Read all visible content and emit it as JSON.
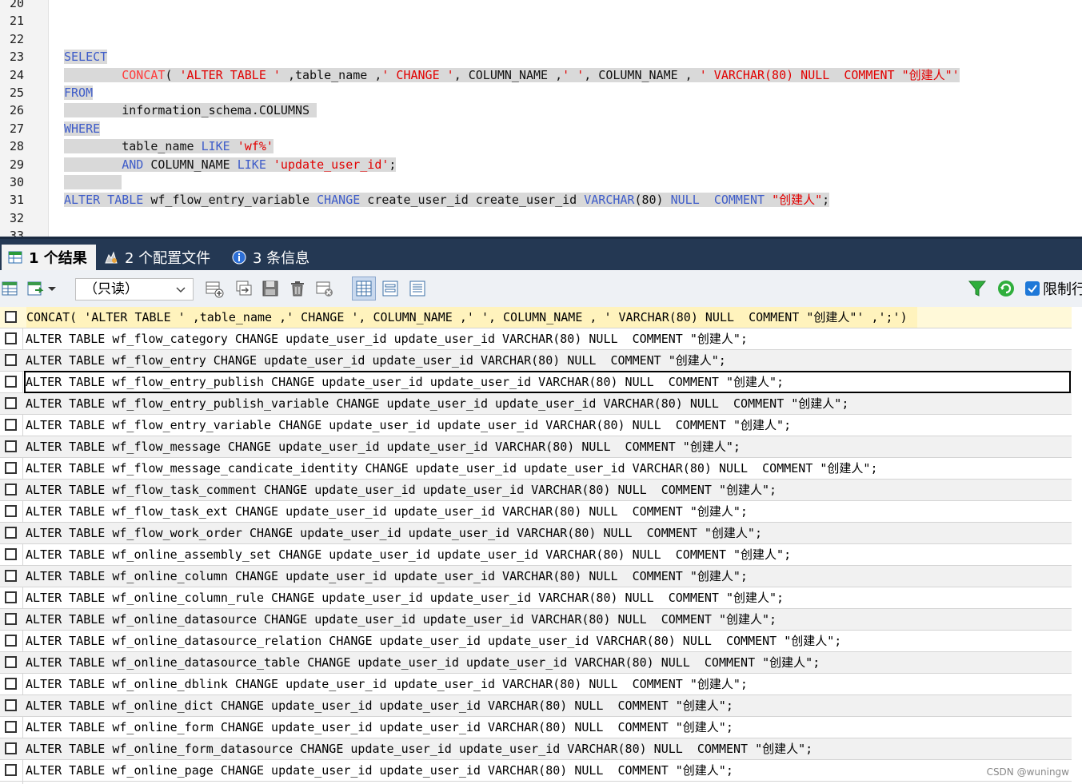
{
  "editor": {
    "line_numbers": [
      "20",
      "21",
      "22",
      "23",
      "24",
      "25",
      "26",
      "27",
      "28",
      "29",
      "30",
      "31",
      "32",
      "33"
    ],
    "lines": [
      {
        "num_index": 3,
        "tokens": [
          {
            "t": "SELECT",
            "c": "kw"
          }
        ]
      },
      {
        "num_index": 4,
        "tokens": [
          {
            "t": "        ",
            "c": "id"
          },
          {
            "t": "CONCAT",
            "c": "fn"
          },
          {
            "t": "( ",
            "c": "id"
          },
          {
            "t": "'ALTER TABLE '",
            "c": "str"
          },
          {
            "t": " ,table_name ,",
            "c": "id"
          },
          {
            "t": "' CHANGE '",
            "c": "str"
          },
          {
            "t": ", COLUMN_NAME ,",
            "c": "id"
          },
          {
            "t": "' '",
            "c": "str"
          },
          {
            "t": ", COLUMN_NAME , ",
            "c": "id"
          },
          {
            "t": "' VARCHAR(80) NULL  COMMENT \"创建人\"'",
            "c": "str"
          }
        ]
      },
      {
        "num_index": 5,
        "tokens": [
          {
            "t": "FROM",
            "c": "kw"
          }
        ]
      },
      {
        "num_index": 6,
        "tokens": [
          {
            "t": "        information_schema.COLUMNS ",
            "c": "id"
          }
        ]
      },
      {
        "num_index": 7,
        "tokens": [
          {
            "t": "WHERE",
            "c": "kw"
          }
        ]
      },
      {
        "num_index": 8,
        "tokens": [
          {
            "t": "        table_name ",
            "c": "id"
          },
          {
            "t": "LIKE",
            "c": "kw"
          },
          {
            "t": " ",
            "c": "id"
          },
          {
            "t": "'wf%'",
            "c": "str"
          }
        ]
      },
      {
        "num_index": 9,
        "tokens": [
          {
            "t": "        ",
            "c": "id"
          },
          {
            "t": "AND",
            "c": "kw"
          },
          {
            "t": " COLUMN_NAME ",
            "c": "id"
          },
          {
            "t": "LIKE",
            "c": "kw"
          },
          {
            "t": " ",
            "c": "id"
          },
          {
            "t": "'update_user_id'",
            "c": "str"
          },
          {
            "t": ";",
            "c": "id"
          }
        ]
      },
      {
        "num_index": 10,
        "tokens": [
          {
            "t": "        ",
            "c": "id"
          }
        ]
      },
      {
        "num_index": 11,
        "tokens": [
          {
            "t": "ALTER TABLE",
            "c": "kw"
          },
          {
            "t": " wf_flow_entry_variable ",
            "c": "id"
          },
          {
            "t": "CHANGE",
            "c": "kw"
          },
          {
            "t": " create_user_id create_user_id ",
            "c": "id"
          },
          {
            "t": "VARCHAR",
            "c": "kw"
          },
          {
            "t": "(80) ",
            "c": "id"
          },
          {
            "t": "NULL",
            "c": "kw"
          },
          {
            "t": "  ",
            "c": "id"
          },
          {
            "t": "COMMENT",
            "c": "kw"
          },
          {
            "t": " ",
            "c": "id"
          },
          {
            "t": "\"创建人\"",
            "c": "str"
          },
          {
            "t": ";",
            "c": "id"
          }
        ]
      }
    ]
  },
  "tabs": [
    {
      "label": "1 个结果",
      "icon": "result-grid-icon",
      "active": true
    },
    {
      "label": "2 个配置文件",
      "icon": "profile-icon",
      "active": false
    },
    {
      "label": "3 条信息",
      "icon": "info-icon",
      "active": false
    }
  ],
  "toolbar": {
    "mode_select": "（只读）",
    "limit_label": "限制行"
  },
  "grid": {
    "header": "CONCAT( 'ALTER TABLE ' ,table_name ,' CHANGE ', COLUMN_NAME ,' ', COLUMN_NAME , ' VARCHAR(80) NULL  COMMENT \"创建人\"' ,';')",
    "selected_index": 2,
    "rows": [
      "ALTER TABLE wf_flow_category CHANGE update_user_id update_user_id VARCHAR(80) NULL  COMMENT \"创建人\";",
      "ALTER TABLE wf_flow_entry CHANGE update_user_id update_user_id VARCHAR(80) NULL  COMMENT \"创建人\";",
      "ALTER TABLE wf_flow_entry_publish CHANGE update_user_id update_user_id VARCHAR(80) NULL  COMMENT \"创建人\";",
      "ALTER TABLE wf_flow_entry_publish_variable CHANGE update_user_id update_user_id VARCHAR(80) NULL  COMMENT \"创建人\";",
      "ALTER TABLE wf_flow_entry_variable CHANGE update_user_id update_user_id VARCHAR(80) NULL  COMMENT \"创建人\";",
      "ALTER TABLE wf_flow_message CHANGE update_user_id update_user_id VARCHAR(80) NULL  COMMENT \"创建人\";",
      "ALTER TABLE wf_flow_message_candicate_identity CHANGE update_user_id update_user_id VARCHAR(80) NULL  COMMENT \"创建人\";",
      "ALTER TABLE wf_flow_task_comment CHANGE update_user_id update_user_id VARCHAR(80) NULL  COMMENT \"创建人\";",
      "ALTER TABLE wf_flow_task_ext CHANGE update_user_id update_user_id VARCHAR(80) NULL  COMMENT \"创建人\";",
      "ALTER TABLE wf_flow_work_order CHANGE update_user_id update_user_id VARCHAR(80) NULL  COMMENT \"创建人\";",
      "ALTER TABLE wf_online_assembly_set CHANGE update_user_id update_user_id VARCHAR(80) NULL  COMMENT \"创建人\";",
      "ALTER TABLE wf_online_column CHANGE update_user_id update_user_id VARCHAR(80) NULL  COMMENT \"创建人\";",
      "ALTER TABLE wf_online_column_rule CHANGE update_user_id update_user_id VARCHAR(80) NULL  COMMENT \"创建人\";",
      "ALTER TABLE wf_online_datasource CHANGE update_user_id update_user_id VARCHAR(80) NULL  COMMENT \"创建人\";",
      "ALTER TABLE wf_online_datasource_relation CHANGE update_user_id update_user_id VARCHAR(80) NULL  COMMENT \"创建人\";",
      "ALTER TABLE wf_online_datasource_table CHANGE update_user_id update_user_id VARCHAR(80) NULL  COMMENT \"创建人\";",
      "ALTER TABLE wf_online_dblink CHANGE update_user_id update_user_id VARCHAR(80) NULL  COMMENT \"创建人\";",
      "ALTER TABLE wf_online_dict CHANGE update_user_id update_user_id VARCHAR(80) NULL  COMMENT \"创建人\";",
      "ALTER TABLE wf_online_form CHANGE update_user_id update_user_id VARCHAR(80) NULL  COMMENT \"创建人\";",
      "ALTER TABLE wf_online_form_datasource CHANGE update_user_id update_user_id VARCHAR(80) NULL  COMMENT \"创建人\";",
      "ALTER TABLE wf_online_page CHANGE update_user_id update_user_id VARCHAR(80) NULL  COMMENT \"创建人\";"
    ]
  },
  "watermark": "CSDN @wuningw",
  "colors": {
    "keyword": "#3e5cc9",
    "function": "#ff3a3a",
    "string": "#e20000",
    "tabbar": "#243853",
    "selection": "#d9d9d9"
  }
}
